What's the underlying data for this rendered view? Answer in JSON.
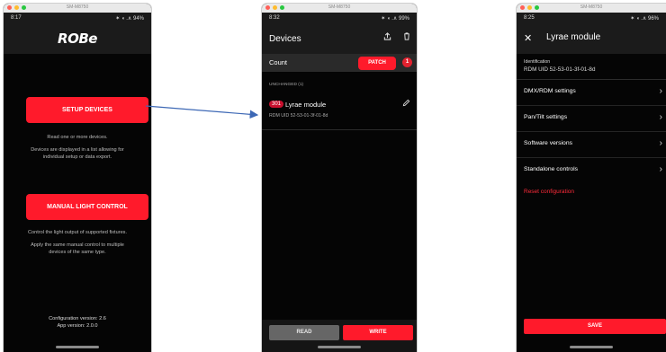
{
  "colors": {
    "accent": "#ff1a2b",
    "background": "#050505",
    "bar": "#1b1b1b"
  },
  "window_title": "SM-M8750",
  "screen1": {
    "time": "8:17",
    "status_icons": "✶ ◖ .∧ 94%",
    "logo": "ROBe",
    "setup_button": "SETUP DEVICES",
    "setup_desc1": "Read one or more devices.",
    "setup_desc2": "Devices are displayed in a list allowing for",
    "setup_desc3": "individual setup or data export.",
    "manual_button": "MANUAL LIGHT CONTROL",
    "manual_desc1": "Control the light output of supported fixtures.",
    "manual_desc2": "Apply the same manual control to multiple",
    "manual_desc3": "devices of the same type.",
    "config_version": "Configuration version: 2.6",
    "app_version": "App version: 2.0.0"
  },
  "screen2": {
    "time": "8:32",
    "status_icons": "✶ ◖ .∧ 99%",
    "title": "Devices",
    "upload_icon": "upload-icon",
    "trash_icon": "trash-icon",
    "count_label": "Count",
    "patch_button": "PATCH",
    "badge": "1",
    "section": "UNCHANGED (1)",
    "device": {
      "number": "301",
      "name": "Lyrae module",
      "uid": "RDM UID 52-53-01-3f-01-8d"
    },
    "read_button": "READ",
    "write_button": "WRITE"
  },
  "screen3": {
    "time": "8:25",
    "status_icons": "✶ ◖ .∧ 96%",
    "title": "Lyrae module",
    "ident_label": "Identification",
    "ident_value": "RDM UID 52-53-01-3f-01-8d",
    "menu": [
      "DMX/RDM settings",
      "Pan/Tilt settings",
      "Software versions",
      "Standalone controls"
    ],
    "reset": "Reset configuration",
    "save_button": "SAVE"
  }
}
